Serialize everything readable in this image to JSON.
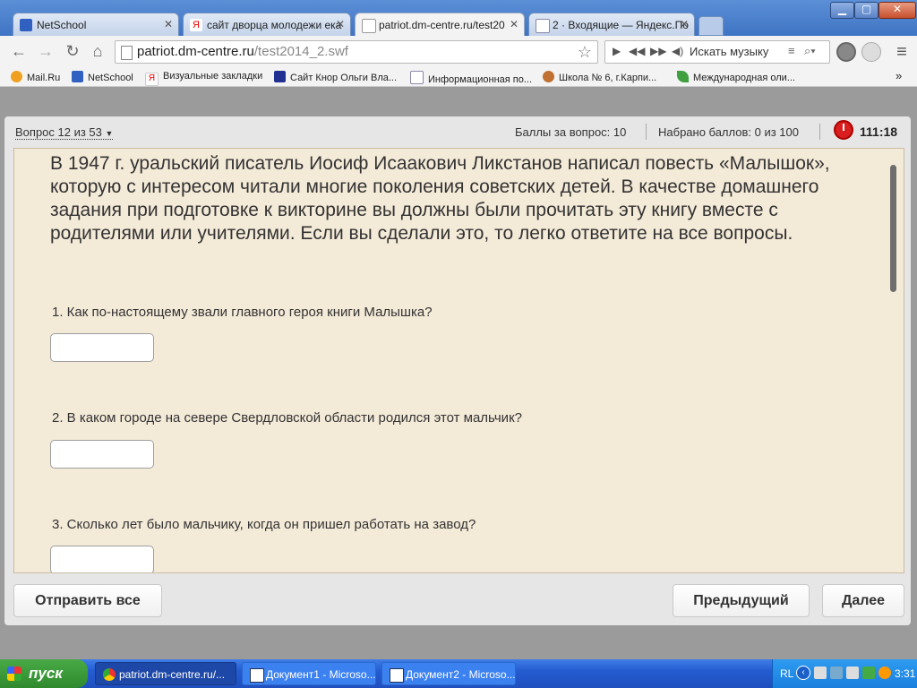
{
  "browser": {
    "tabs": [
      {
        "label": "NetSchool",
        "icon": "netschool-icon"
      },
      {
        "label": "сайт дворца молодежи ека",
        "icon": "yandex-icon"
      },
      {
        "label": "patriot.dm-centre.ru/test20",
        "icon": "page-icon"
      },
      {
        "label": "2 · Входящие — Яндекс.По",
        "icon": "mail-icon"
      }
    ],
    "url_host": "patriot.dm-centre.ru",
    "url_path": "/test2014_2.swf",
    "music_label": "Искать музыку",
    "bookmarks": [
      {
        "label": "Mail.Ru",
        "color": "#f0a020"
      },
      {
        "label": "NetSchool",
        "color": "#3060c0"
      },
      {
        "label": "Визуальные закладки",
        "color": "#e03030"
      },
      {
        "label": "Сайт Кнор Ольги Вла...",
        "color": "#203090"
      },
      {
        "label": "Информационная по...",
        "color": "#4a7ad0"
      },
      {
        "label": "Школа № 6, г.Карпи...",
        "color": "#c07030"
      },
      {
        "label": "Международная оли...",
        "color": "#40a040"
      }
    ],
    "bookmarks_more": "»"
  },
  "quiz": {
    "question_nav": "Вопрос 12 из 53",
    "points_for_question": "Баллы за вопрос: 10",
    "points_total": "Набрано баллов: 0 из 100",
    "timer": "111:18",
    "intro": "В 1947 г. уральский писатель Иосиф Исаакович Ликстанов написал повесть «Малышок», которую с интересом читали многие поколения советских детей. В качестве домашнего задания при подготовке к викторине вы должны были прочитать эту книгу вместе с родителями или учителями. Если вы сделали это, то легко ответите на все вопросы.",
    "questions": [
      {
        "text": "1. Как по-настоящему звали главного героя книги  Малышка?",
        "answer": ""
      },
      {
        "text": "2. В каком городе на севере Свердловской области родился этот мальчик?",
        "answer": ""
      },
      {
        "text": "3. Сколько лет было мальчику, когда он пришел работать на завод?",
        "answer": ""
      }
    ],
    "buttons": {
      "submit_all": "Отправить все",
      "previous": "Предыдущий",
      "next": "Далее"
    }
  },
  "taskbar": {
    "start": "пуск",
    "tasks": [
      {
        "label": "patriot.dm-centre.ru/..."
      },
      {
        "label": "Документ1 - Microso..."
      },
      {
        "label": "Документ2 - Microso..."
      }
    ],
    "lang": "RL",
    "clock": "3:31"
  },
  "colors": {
    "quiz_background": "#f4ead8",
    "timer_red": "#d81e1e",
    "xp_blue": "#245cd0"
  }
}
